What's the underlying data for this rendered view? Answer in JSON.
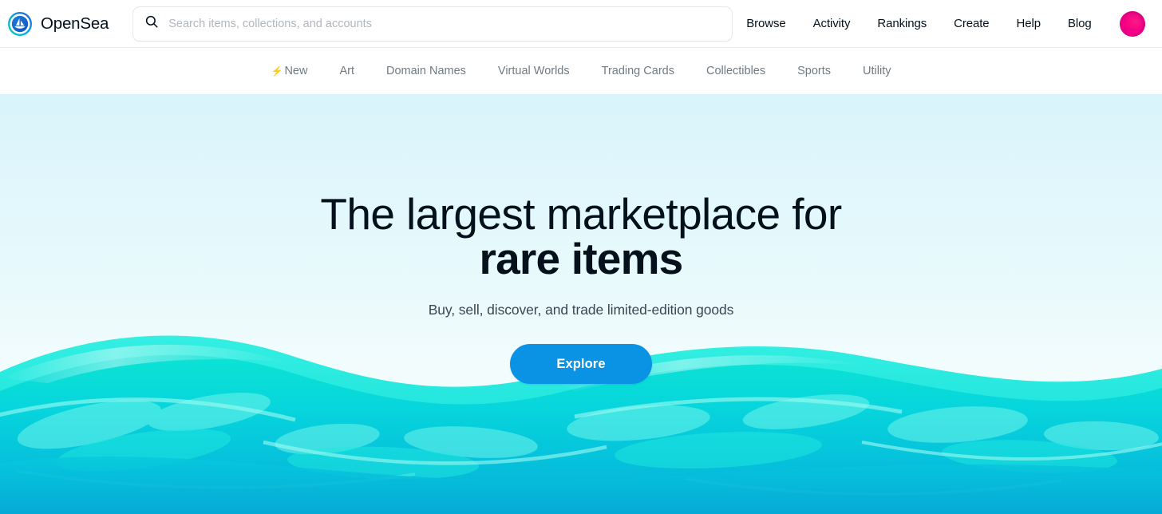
{
  "brand": {
    "name": "OpenSea",
    "logo_icon": "opensea-sailboat-logo"
  },
  "search": {
    "icon": "search-icon",
    "placeholder": "Search items, collections, and accounts",
    "value": ""
  },
  "nav": {
    "items": [
      {
        "label": "Browse"
      },
      {
        "label": "Activity"
      },
      {
        "label": "Rankings"
      },
      {
        "label": "Create"
      },
      {
        "label": "Help"
      },
      {
        "label": "Blog"
      }
    ],
    "avatar_icon": "user-avatar",
    "avatar_color": "#f50083"
  },
  "categories": {
    "items": [
      {
        "label": "New",
        "icon": "lightning-bolt-icon",
        "bolt": "⚡"
      },
      {
        "label": "Art",
        "icon": ""
      },
      {
        "label": "Domain Names",
        "icon": ""
      },
      {
        "label": "Virtual Worlds",
        "icon": ""
      },
      {
        "label": "Trading Cards",
        "icon": ""
      },
      {
        "label": "Collectibles",
        "icon": ""
      },
      {
        "label": "Sports",
        "icon": ""
      },
      {
        "label": "Utility",
        "icon": ""
      }
    ]
  },
  "hero": {
    "headline_line1": "The largest marketplace for",
    "headline_line2": "rare items",
    "subheadline": "Buy, sell, discover, and trade limited-edition goods",
    "cta_label": "Explore",
    "cta_color": "#0a93e4",
    "background_top_color": "#d9f4fb",
    "background_bottom_color": "#f8fdfe",
    "wave_light_color": "#0ce0d6",
    "wave_mid_color": "#0ad4dd",
    "wave_deep_color": "#07afd8"
  }
}
